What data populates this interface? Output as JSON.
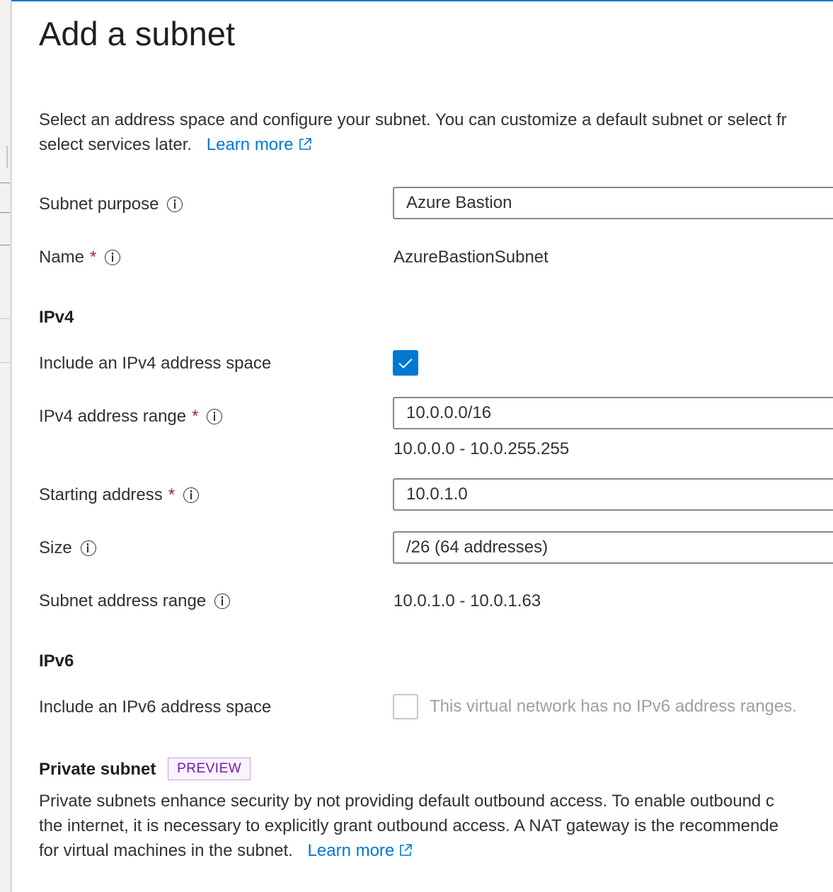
{
  "panel": {
    "title": "Add a subnet",
    "description_line1": "Select an address space and configure your subnet. You can customize a default subnet or select fr",
    "description_line2": "select services later.",
    "learn_more": "Learn more"
  },
  "form": {
    "subnet_purpose": {
      "label": "Subnet purpose",
      "value": "Azure Bastion"
    },
    "name": {
      "label": "Name",
      "required": "*",
      "value": "AzureBastionSubnet"
    },
    "ipv4": {
      "heading": "IPv4",
      "include_label": "Include an IPv4 address space",
      "include_checked": true,
      "range_label": "IPv4 address range",
      "required": "*",
      "range_value": "10.0.0.0/16",
      "range_hint": "10.0.0.0 - 10.0.255.255",
      "start_label": "Starting address",
      "start_value": "10.0.1.0",
      "size_label": "Size",
      "size_value": "/26 (64 addresses)",
      "subnet_range_label": "Subnet address range",
      "subnet_range_value": "10.0.1.0 - 10.0.1.63"
    },
    "ipv6": {
      "heading": "IPv6",
      "include_label": "Include an IPv6 address space",
      "include_checked": false,
      "disabled_note": "This virtual network has no IPv6 address ranges."
    },
    "private_subnet": {
      "heading": "Private subnet",
      "badge": "PREVIEW",
      "line1": "Private subnets enhance security by not providing default outbound access. To enable outbound c",
      "line2": "the internet, it is necessary to explicitly grant outbound access. A NAT gateway is the recommende",
      "line3": "for virtual machines in the subnet.",
      "learn_more": "Learn more"
    }
  },
  "colors": {
    "accent": "#0078d4",
    "required": "#a4262c",
    "preview_badge_text": "#7719aa",
    "preview_badge_border": "#c5a1e0"
  },
  "icons": {
    "info": "info-circle-icon",
    "external_link": "external-link-icon",
    "check": "checkmark-icon"
  }
}
